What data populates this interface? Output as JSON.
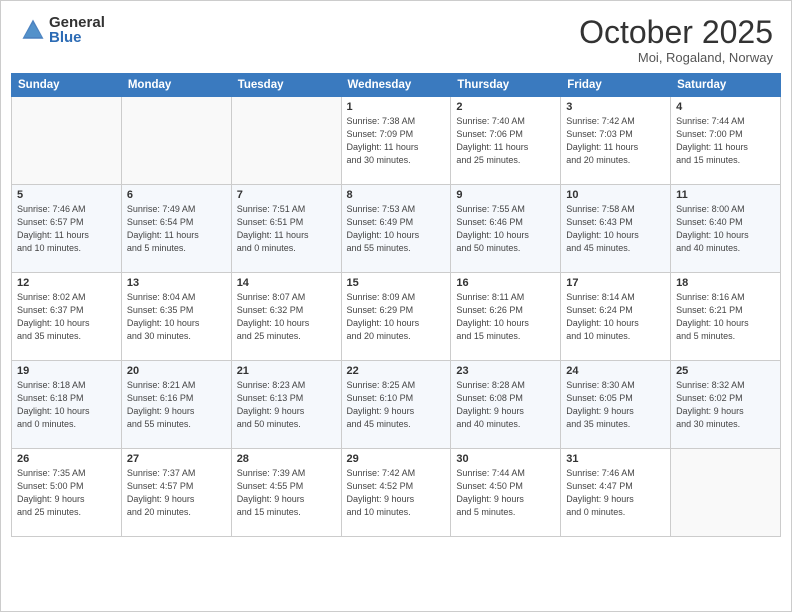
{
  "header": {
    "logo_general": "General",
    "logo_blue": "Blue",
    "month": "October 2025",
    "location": "Moi, Rogaland, Norway"
  },
  "days_of_week": [
    "Sunday",
    "Monday",
    "Tuesday",
    "Wednesday",
    "Thursday",
    "Friday",
    "Saturday"
  ],
  "weeks": [
    [
      {
        "day": "",
        "info": ""
      },
      {
        "day": "",
        "info": ""
      },
      {
        "day": "",
        "info": ""
      },
      {
        "day": "1",
        "info": "Sunrise: 7:38 AM\nSunset: 7:09 PM\nDaylight: 11 hours\nand 30 minutes."
      },
      {
        "day": "2",
        "info": "Sunrise: 7:40 AM\nSunset: 7:06 PM\nDaylight: 11 hours\nand 25 minutes."
      },
      {
        "day": "3",
        "info": "Sunrise: 7:42 AM\nSunset: 7:03 PM\nDaylight: 11 hours\nand 20 minutes."
      },
      {
        "day": "4",
        "info": "Sunrise: 7:44 AM\nSunset: 7:00 PM\nDaylight: 11 hours\nand 15 minutes."
      }
    ],
    [
      {
        "day": "5",
        "info": "Sunrise: 7:46 AM\nSunset: 6:57 PM\nDaylight: 11 hours\nand 10 minutes."
      },
      {
        "day": "6",
        "info": "Sunrise: 7:49 AM\nSunset: 6:54 PM\nDaylight: 11 hours\nand 5 minutes."
      },
      {
        "day": "7",
        "info": "Sunrise: 7:51 AM\nSunset: 6:51 PM\nDaylight: 11 hours\nand 0 minutes."
      },
      {
        "day": "8",
        "info": "Sunrise: 7:53 AM\nSunset: 6:49 PM\nDaylight: 10 hours\nand 55 minutes."
      },
      {
        "day": "9",
        "info": "Sunrise: 7:55 AM\nSunset: 6:46 PM\nDaylight: 10 hours\nand 50 minutes."
      },
      {
        "day": "10",
        "info": "Sunrise: 7:58 AM\nSunset: 6:43 PM\nDaylight: 10 hours\nand 45 minutes."
      },
      {
        "day": "11",
        "info": "Sunrise: 8:00 AM\nSunset: 6:40 PM\nDaylight: 10 hours\nand 40 minutes."
      }
    ],
    [
      {
        "day": "12",
        "info": "Sunrise: 8:02 AM\nSunset: 6:37 PM\nDaylight: 10 hours\nand 35 minutes."
      },
      {
        "day": "13",
        "info": "Sunrise: 8:04 AM\nSunset: 6:35 PM\nDaylight: 10 hours\nand 30 minutes."
      },
      {
        "day": "14",
        "info": "Sunrise: 8:07 AM\nSunset: 6:32 PM\nDaylight: 10 hours\nand 25 minutes."
      },
      {
        "day": "15",
        "info": "Sunrise: 8:09 AM\nSunset: 6:29 PM\nDaylight: 10 hours\nand 20 minutes."
      },
      {
        "day": "16",
        "info": "Sunrise: 8:11 AM\nSunset: 6:26 PM\nDaylight: 10 hours\nand 15 minutes."
      },
      {
        "day": "17",
        "info": "Sunrise: 8:14 AM\nSunset: 6:24 PM\nDaylight: 10 hours\nand 10 minutes."
      },
      {
        "day": "18",
        "info": "Sunrise: 8:16 AM\nSunset: 6:21 PM\nDaylight: 10 hours\nand 5 minutes."
      }
    ],
    [
      {
        "day": "19",
        "info": "Sunrise: 8:18 AM\nSunset: 6:18 PM\nDaylight: 10 hours\nand 0 minutes."
      },
      {
        "day": "20",
        "info": "Sunrise: 8:21 AM\nSunset: 6:16 PM\nDaylight: 9 hours\nand 55 minutes."
      },
      {
        "day": "21",
        "info": "Sunrise: 8:23 AM\nSunset: 6:13 PM\nDaylight: 9 hours\nand 50 minutes."
      },
      {
        "day": "22",
        "info": "Sunrise: 8:25 AM\nSunset: 6:10 PM\nDaylight: 9 hours\nand 45 minutes."
      },
      {
        "day": "23",
        "info": "Sunrise: 8:28 AM\nSunset: 6:08 PM\nDaylight: 9 hours\nand 40 minutes."
      },
      {
        "day": "24",
        "info": "Sunrise: 8:30 AM\nSunset: 6:05 PM\nDaylight: 9 hours\nand 35 minutes."
      },
      {
        "day": "25",
        "info": "Sunrise: 8:32 AM\nSunset: 6:02 PM\nDaylight: 9 hours\nand 30 minutes."
      }
    ],
    [
      {
        "day": "26",
        "info": "Sunrise: 7:35 AM\nSunset: 5:00 PM\nDaylight: 9 hours\nand 25 minutes."
      },
      {
        "day": "27",
        "info": "Sunrise: 7:37 AM\nSunset: 4:57 PM\nDaylight: 9 hours\nand 20 minutes."
      },
      {
        "day": "28",
        "info": "Sunrise: 7:39 AM\nSunset: 4:55 PM\nDaylight: 9 hours\nand 15 minutes."
      },
      {
        "day": "29",
        "info": "Sunrise: 7:42 AM\nSunset: 4:52 PM\nDaylight: 9 hours\nand 10 minutes."
      },
      {
        "day": "30",
        "info": "Sunrise: 7:44 AM\nSunset: 4:50 PM\nDaylight: 9 hours\nand 5 minutes."
      },
      {
        "day": "31",
        "info": "Sunrise: 7:46 AM\nSunset: 4:47 PM\nDaylight: 9 hours\nand 0 minutes."
      },
      {
        "day": "",
        "info": ""
      }
    ]
  ]
}
